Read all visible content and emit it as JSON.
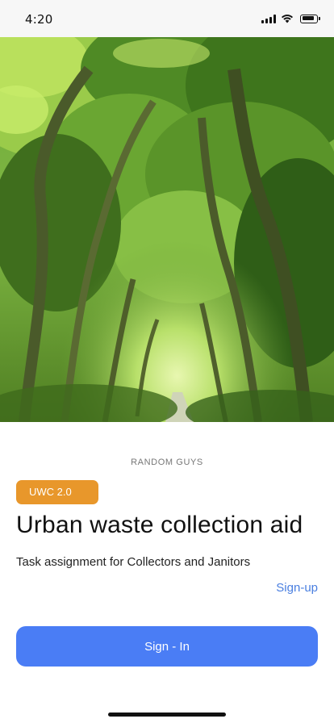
{
  "status_bar": {
    "time": "4:20",
    "icons": [
      "cellular-signal-icon",
      "wifi-icon",
      "battery-icon"
    ]
  },
  "hero": {
    "image": "tree-lined-path-photo"
  },
  "content": {
    "brand": "RANDOM GUYS",
    "tag": "UWC 2.0",
    "title": "Urban waste collection aid",
    "subtitle": "Task assignment for Collectors and Janitors",
    "signup_label": "Sign-up",
    "signin_label": "Sign - In"
  },
  "colors": {
    "tag_bg": "#e8972b",
    "primary_button": "#4a7df5",
    "link": "#4a7fe0"
  }
}
